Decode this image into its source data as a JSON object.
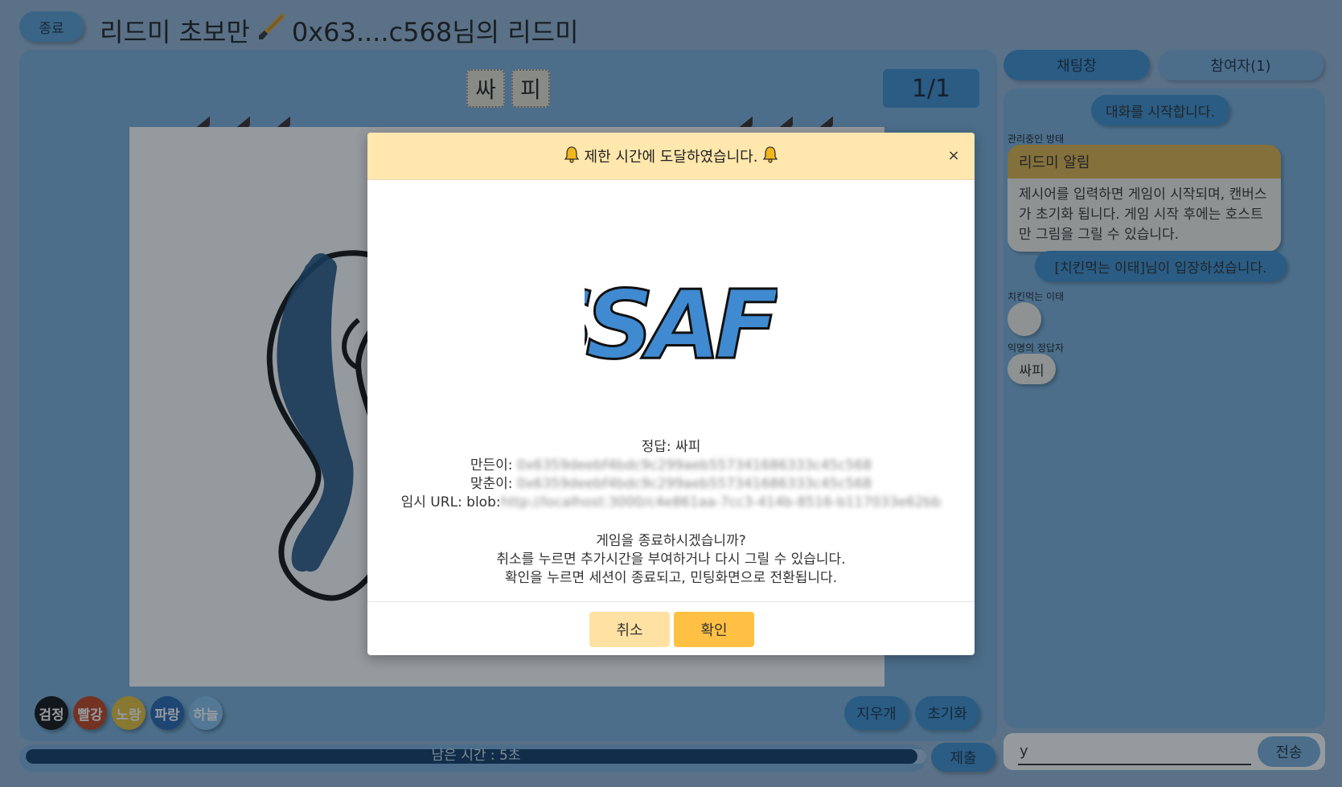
{
  "header": {
    "exit_label": "종료",
    "title_prefix": "리드미 초보만",
    "title_suffix": "0x63....c568님의 리드미"
  },
  "board": {
    "hint_chars": [
      "싸",
      "피"
    ],
    "round": "1/1",
    "colors": [
      {
        "label": "검정",
        "color": "#111111",
        "text": "#ffffff"
      },
      {
        "label": "빨강",
        "color": "#c3421f",
        "text": "#ffffff"
      },
      {
        "label": "노랑",
        "color": "#e8c23a",
        "text": "#ffffff"
      },
      {
        "label": "파랑",
        "color": "#2766b4",
        "text": "#ffffff"
      },
      {
        "label": "하늘",
        "color": "#86c2ef",
        "text": "#ffffff"
      }
    ],
    "eraser_label": "지우개",
    "reset_label": "초기화"
  },
  "timer": {
    "text": "남은 시간 : 5초",
    "remaining_fraction": 0.99,
    "submit_label": "제출"
  },
  "tabs": {
    "chat_label": "채팅창",
    "participants_label": "참여자(1)"
  },
  "chat": {
    "system_start": "대화를 시작합니다.",
    "admin_sender": "관리중인 방태",
    "admin_title": "리드미 알림",
    "admin_text": "제시어를 입력하면 게임이 시작되며, 캔버스가 초기화 됩니다. 게임 시작 후에는 호스트만 그림을 그릴 수 있습니다.",
    "join_notice": "[치킨먹는 이태]님이 입장하셨습니다.",
    "user1_sender": "치킨먹는 이태",
    "user2_sender": "익명의 정답자",
    "user2_message": "싸피",
    "input_value": "y",
    "send_label": "전송"
  },
  "modal": {
    "title": "제한 시간에 도달하였습니다.",
    "close_icon": "×",
    "drawing_text": "SSAFY",
    "answer_line": "정답: 싸피",
    "maker_label": "만든이: ",
    "maker_value": "0x6359deebf4bdc9c299aeb557341686333c45c568",
    "solver_label": "맞춘이: ",
    "solver_value": "0x6359deebf4bdc9c299aeb557341686333c45c568",
    "url_label": "임시 URL: blob:",
    "url_value": "http://localhost:3000/c4e861aa-7cc3-414b-8516-b117033e62bb",
    "message_lines": [
      "게임을 종료하시겠습니까?",
      "취소를 누르면 추가시간을 부여하거나 다시 그릴 수 있습니다.",
      "확인을 누르면 세션이 종료되고, 민팅화면으로 전환됩니다."
    ],
    "cancel_label": "취소",
    "confirm_label": "확인",
    "colors": {
      "header_bg": "#ffe7ad",
      "cancel_bg": "#ffe2a3",
      "confirm_bg": "#ffc043",
      "accent": "#3d8fcf"
    }
  }
}
